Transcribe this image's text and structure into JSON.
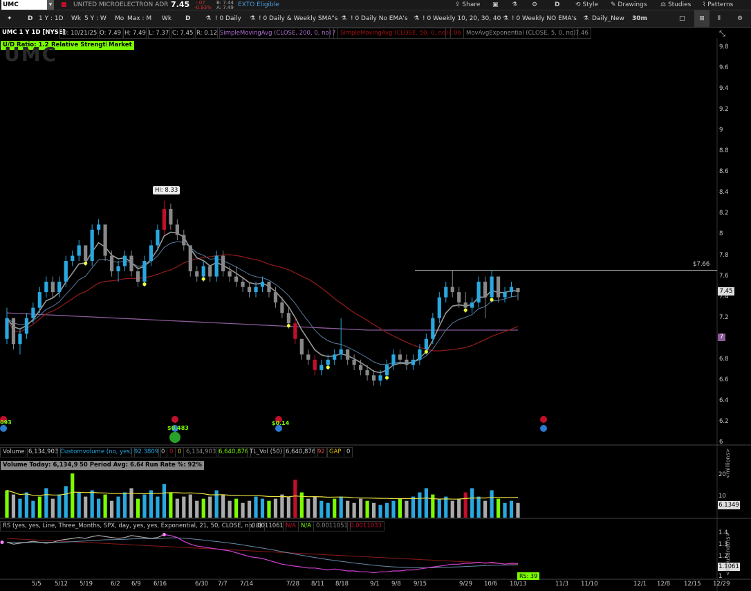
{
  "topbar": {
    "symbol": "UMC",
    "company": "UNITED MICROELECTRON ADR",
    "last": "7.45",
    "change": "-.07",
    "change_pct": "-0.93%",
    "bid": "B: 7.44",
    "ask": "A: 7.49",
    "eligibility": "EXTO Eligible",
    "share": "Share",
    "timeframe_letter": "D",
    "style": "Style",
    "drawings": "Drawings",
    "studies": "Studies",
    "patterns": "Patterns"
  },
  "toolbar": {
    "items": [
      "D",
      "1 Y : 1D",
      "Wk",
      "5 Y : W",
      "Mo",
      "Max : M",
      "Wk",
      "D",
      "! 0 Daily",
      "! 0 Daily & Weekly SMA\"s",
      "! 0 Daily No EMA's",
      "! 0 Weekly 10, 20, 30, 40",
      "! 0 Weekly NO EMA's",
      "Daily_New",
      "30m"
    ]
  },
  "study_row": {
    "title": "UMC 1 Y 1D [NYSE]",
    "date": "D: 10/21/25",
    "open": "O: 7.49",
    "high": "H: 7.49",
    "low": "L: 7.37",
    "close": "C: 7.45",
    "range": "R: 0.12",
    "sma200": "SimpleMovingAvg (CLOSE, 200, 0, no)",
    "sma200_val": "7",
    "sma50": "SimpleMovingAvg (CLOSE, 50, 0, no)",
    "sma50_val": "7.06",
    "ema5": "MovAvgExponential (CLOSE, 5, 0, no)",
    "ema5_val": "7.46"
  },
  "badges": {
    "ud_ratio": "U/D Ratio: 1.24",
    "rel_strength": "Relative Strength",
    "market": "Market"
  },
  "watermark": "UMC",
  "price_axis": [
    "9.8",
    "9.6",
    "9.4",
    "9.2",
    "9",
    "8.8",
    "8.6",
    "8.4",
    "8.2",
    "8",
    "7.8",
    "7.6",
    "7.4",
    "7.2",
    "7",
    "6.8",
    "6.6",
    "6.4",
    "6.2",
    "6"
  ],
  "current_price_tag": "7.45",
  "sma200_tag": "7",
  "hi_label": "Hi: 8.33",
  "resistance_label": "$7.66",
  "events": {
    "left_val": "093",
    "div1": "$0.483",
    "div2": "$0.14"
  },
  "volume_row": {
    "volume": "Volume",
    "volume_val": "6,134,903",
    "custom": "Customvolume (no, yes)",
    "custom_val": "92.3809",
    "z1": "0",
    "z2": "0",
    "z3": "0",
    "vol_val2": "6,134,903",
    "vol_val3": "6,640,876",
    "tl_vol": "TL_Vol (50)",
    "tl_vol_val": "6,640,876",
    "n92": "92",
    "gap": "GAP",
    "gap_val": "0"
  },
  "volume_badges": {
    "today": "Volume Today: 6,134,903",
    "avg": "50 Period Avg: 6.64m",
    "run_rate": "Run Rate %: 92%"
  },
  "volume_axis": [
    "20",
    "10"
  ],
  "volume_tag": "6.1349",
  "volume_unit": "<millions>",
  "rs_row": {
    "title": "RS (yes, yes, Line, Three_Months, SPX, day, yes, yes, Exponential, 21, 50, CLOSE, no, 0)",
    "v1": "0.0011061",
    "na1": "N/A",
    "na2": "N/A",
    "v2": "0.0011051",
    "v3": "0.0011033"
  },
  "rs_axis": [
    "1.4",
    "1.2",
    "1"
  ],
  "rs_extra_ticks": [
    "1.3",
    "1.1"
  ],
  "rs_tag": "1.1061",
  "rs_unit": "<thousandths>",
  "rs_label": "RS: 39",
  "x_axis": [
    "5/5",
    "5/12",
    "5/19",
    "6/2",
    "6/9",
    "6/16",
    "6/30",
    "7/7",
    "7/14",
    "7/28",
    "8/11",
    "8/18",
    "9/1",
    "9/8",
    "9/15",
    "9/29",
    "10/6",
    "10/13",
    "11/3",
    "11/10",
    "12/1",
    "12/8",
    "12/15",
    "12/29"
  ],
  "colors": {
    "up": "#29a8e0",
    "down": "#888888",
    "red": "#c0102a",
    "green": "#7cfc00",
    "magenta": "#d040d0",
    "sma50": "#8b1a1a",
    "sma200": "#8a5a9a"
  },
  "chart_data": {
    "type": "candlestick",
    "symbol": "UMC",
    "price_axis_range": [
      6.0,
      9.9
    ],
    "candles": [
      [
        7.0,
        7.3,
        6.95,
        7.2
      ],
      [
        7.2,
        7.2,
        6.9,
        6.95
      ],
      [
        6.95,
        7.1,
        6.85,
        7.05
      ],
      [
        7.05,
        7.25,
        7.0,
        7.2
      ],
      [
        7.2,
        7.35,
        7.15,
        7.3
      ],
      [
        7.3,
        7.5,
        7.25,
        7.45
      ],
      [
        7.45,
        7.6,
        7.4,
        7.55
      ],
      [
        7.55,
        7.6,
        7.4,
        7.45
      ],
      [
        7.45,
        7.6,
        7.4,
        7.55
      ],
      [
        7.55,
        7.8,
        7.5,
        7.75
      ],
      [
        7.75,
        7.85,
        7.7,
        7.8
      ],
      [
        7.8,
        7.95,
        7.75,
        7.9
      ],
      [
        7.9,
        7.9,
        7.7,
        7.75
      ],
      [
        7.75,
        8.1,
        7.7,
        8.05
      ],
      [
        8.05,
        8.15,
        8.0,
        8.1
      ],
      [
        8.1,
        8.1,
        7.75,
        7.8
      ],
      [
        7.8,
        7.85,
        7.6,
        7.65
      ],
      [
        7.65,
        7.75,
        7.55,
        7.7
      ],
      [
        7.7,
        7.85,
        7.65,
        7.8
      ],
      [
        7.8,
        7.85,
        7.6,
        7.65
      ],
      [
        7.65,
        7.7,
        7.5,
        7.55
      ],
      [
        7.55,
        7.8,
        7.5,
        7.75
      ],
      [
        7.75,
        7.95,
        7.7,
        7.9
      ],
      [
        7.9,
        8.1,
        7.85,
        8.05
      ],
      [
        8.05,
        8.33,
        8.0,
        8.25
      ],
      [
        8.25,
        8.3,
        8.05,
        8.1
      ],
      [
        8.1,
        8.15,
        7.95,
        8.0
      ],
      [
        8.0,
        8.05,
        7.85,
        7.9
      ],
      [
        7.9,
        7.9,
        7.6,
        7.65
      ],
      [
        7.65,
        7.7,
        7.55,
        7.6
      ],
      [
        7.6,
        7.75,
        7.55,
        7.7
      ],
      [
        7.7,
        7.7,
        7.55,
        7.6
      ],
      [
        7.6,
        7.85,
        7.55,
        7.8
      ],
      [
        7.8,
        7.85,
        7.6,
        7.65
      ],
      [
        7.65,
        7.7,
        7.55,
        7.6
      ],
      [
        7.6,
        7.7,
        7.5,
        7.55
      ],
      [
        7.55,
        7.6,
        7.45,
        7.5
      ],
      [
        7.5,
        7.55,
        7.4,
        7.45
      ],
      [
        7.45,
        7.55,
        7.4,
        7.5
      ],
      [
        7.5,
        7.6,
        7.45,
        7.55
      ],
      [
        7.55,
        7.55,
        7.4,
        7.45
      ],
      [
        7.45,
        7.5,
        7.3,
        7.35
      ],
      [
        7.35,
        7.4,
        7.2,
        7.25
      ],
      [
        7.25,
        7.3,
        7.1,
        7.15
      ],
      [
        7.15,
        7.2,
        6.95,
        7.0
      ],
      [
        7.0,
        7.0,
        6.8,
        6.85
      ],
      [
        6.85,
        6.9,
        6.75,
        6.8
      ],
      [
        6.8,
        6.85,
        6.65,
        6.7
      ],
      [
        6.7,
        6.8,
        6.65,
        6.75
      ],
      [
        6.75,
        6.85,
        6.7,
        6.8
      ],
      [
        6.8,
        6.9,
        6.75,
        6.85
      ],
      [
        6.85,
        7.2,
        6.8,
        6.9
      ],
      [
        6.9,
        6.9,
        6.75,
        6.8
      ],
      [
        6.8,
        6.85,
        6.7,
        6.75
      ],
      [
        6.75,
        6.8,
        6.65,
        6.7
      ],
      [
        6.7,
        6.75,
        6.6,
        6.65
      ],
      [
        6.65,
        6.7,
        6.55,
        6.6
      ],
      [
        6.6,
        6.7,
        6.55,
        6.65
      ],
      [
        6.65,
        6.8,
        6.6,
        6.75
      ],
      [
        6.75,
        6.9,
        6.7,
        6.85
      ],
      [
        6.85,
        6.9,
        6.75,
        6.8
      ],
      [
        6.8,
        6.85,
        6.7,
        6.75
      ],
      [
        6.75,
        6.85,
        6.7,
        6.8
      ],
      [
        6.8,
        6.95,
        6.75,
        6.9
      ],
      [
        6.9,
        7.05,
        6.85,
        7.0
      ],
      [
        7.0,
        7.25,
        6.95,
        7.2
      ],
      [
        7.2,
        7.45,
        7.15,
        7.4
      ],
      [
        7.4,
        7.55,
        7.35,
        7.5
      ],
      [
        7.5,
        7.66,
        7.4,
        7.45
      ],
      [
        7.45,
        7.5,
        7.3,
        7.35
      ],
      [
        7.35,
        7.45,
        7.25,
        7.3
      ],
      [
        7.3,
        7.4,
        7.25,
        7.35
      ],
      [
        7.35,
        7.6,
        7.3,
        7.55
      ],
      [
        7.55,
        7.6,
        7.2,
        7.4
      ],
      [
        7.4,
        7.66,
        7.35,
        7.6
      ],
      [
        7.6,
        7.6,
        7.35,
        7.4
      ],
      [
        7.4,
        7.5,
        7.35,
        7.45
      ],
      [
        7.45,
        7.55,
        7.4,
        7.5
      ],
      [
        7.49,
        7.49,
        7.37,
        7.45
      ]
    ],
    "volume_millions": [
      13,
      11,
      9,
      12,
      8,
      10,
      14,
      9,
      11,
      15,
      21,
      12,
      10,
      13,
      9,
      11,
      8,
      10,
      12,
      14,
      9,
      11,
      13,
      10,
      16,
      12,
      9,
      10,
      11,
      8,
      9,
      10,
      13,
      11,
      8,
      9,
      7,
      8,
      10,
      9,
      8,
      9,
      11,
      10,
      18,
      12,
      9,
      10,
      8,
      7,
      9,
      10,
      8,
      7,
      9,
      8,
      7,
      6,
      7,
      8,
      9,
      8,
      10,
      12,
      14,
      11,
      9,
      10,
      8,
      9,
      12,
      14,
      10,
      8,
      13,
      9,
      7,
      8,
      7
    ],
    "volume_axis_range": [
      0,
      25
    ],
    "rs_axis_range": [
      0.95,
      1.45
    ],
    "rs_values": [
      1.33,
      1.31,
      1.32,
      1.33,
      1.34,
      1.33,
      1.32,
      1.33,
      1.35,
      1.36,
      1.37,
      1.38,
      1.37,
      1.39,
      1.4,
      1.39,
      1.38,
      1.37,
      1.38,
      1.4,
      1.39,
      1.38,
      1.37,
      1.38,
      1.41,
      1.4,
      1.38,
      1.34,
      1.31,
      1.29,
      1.28,
      1.27,
      1.26,
      1.25,
      1.24,
      1.22,
      1.2,
      1.18,
      1.17,
      1.16,
      1.14,
      1.12,
      1.1,
      1.09,
      1.08,
      1.07,
      1.06,
      1.06,
      1.05,
      1.04,
      1.05,
      1.04,
      1.03,
      1.03,
      1.02,
      1.02,
      1.01,
      1.02,
      1.02,
      1.03,
      1.03,
      1.04,
      1.04,
      1.05,
      1.06,
      1.07,
      1.08,
      1.09,
      1.1,
      1.1,
      1.11,
      1.11,
      1.12,
      1.11,
      1.12,
      1.11,
      1.1,
      1.11,
      1.106
    ]
  }
}
